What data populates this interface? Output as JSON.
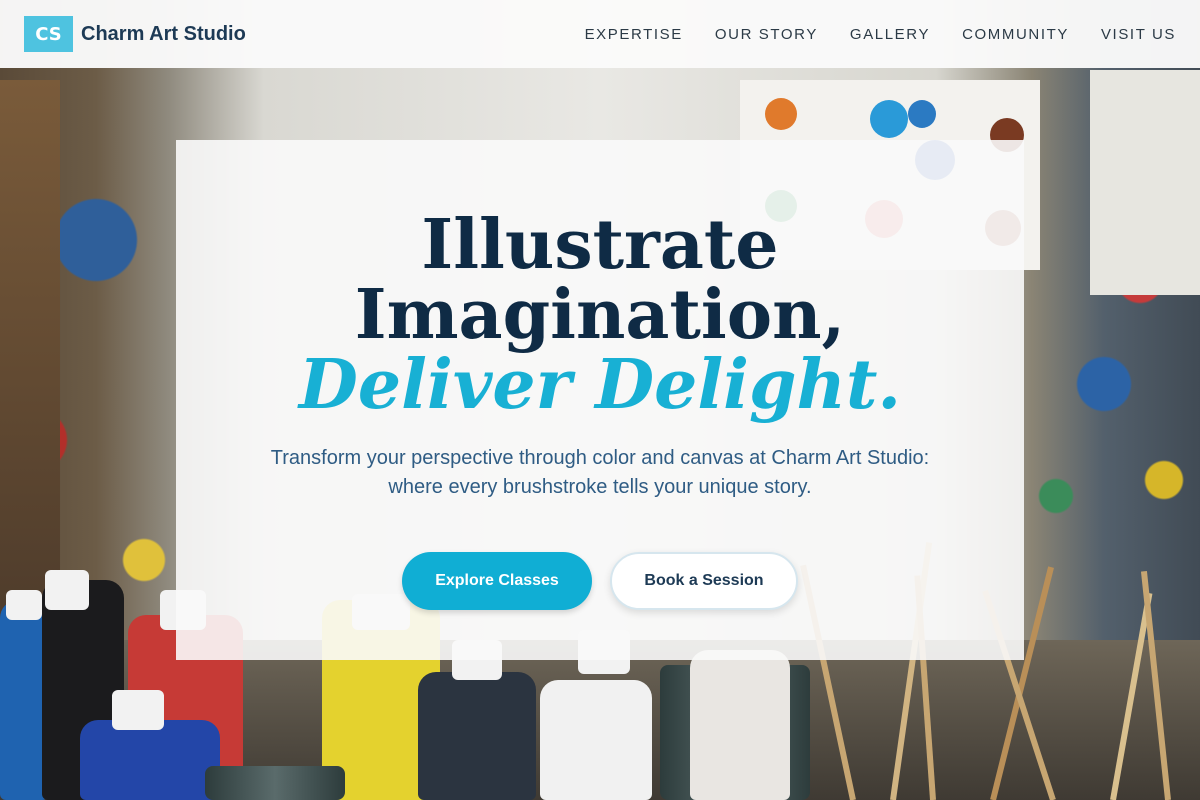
{
  "header": {
    "logo_mark": "CS",
    "brand_name": "Charm Art Studio",
    "nav": [
      {
        "label": "EXPERTISE"
      },
      {
        "label": "OUR STORY"
      },
      {
        "label": "GALLERY"
      },
      {
        "label": "COMMUNITY"
      },
      {
        "label": "VISIT US"
      }
    ]
  },
  "hero": {
    "heading_line1": "Illustrate",
    "heading_line2": "Imagination,",
    "heading_accent": "Deliver Delight.",
    "subtitle": "Transform your perspective through color and canvas at Charm Art Studio: where every brushstroke tells your unique story.",
    "primary_button": "Explore Classes",
    "secondary_button": "Book a Session"
  },
  "colors": {
    "accent": "#10aed4",
    "brand_dark": "#1d3a55",
    "logo_bg": "#4ec3e0"
  }
}
